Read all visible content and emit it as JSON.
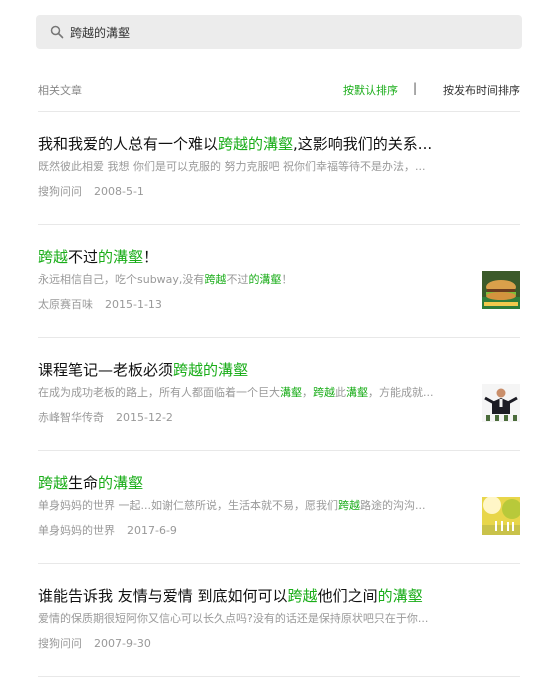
{
  "search": {
    "query": "跨越的溝壑"
  },
  "filter": {
    "label": "相关文章",
    "option_default": "按默认排序",
    "separator": "|",
    "option_time": "按发布时间排序"
  },
  "results": [
    {
      "title": [
        {
          "t": "我和我爱的人总有一个难以",
          "hl": false
        },
        {
          "t": "跨越的溝壑",
          "hl": true
        },
        {
          "t": ",这影响我们的关系...",
          "hl": false
        }
      ],
      "snippet": [
        {
          "t": "既然彼此相爱 我想 你们是可以克服的 努力克服吧 祝你们幸福等待不是办法，...",
          "hl": false
        }
      ],
      "source": "搜狗问问",
      "date": "2008-5-1",
      "thumb": null
    },
    {
      "title": [
        {
          "t": "跨越",
          "hl": true
        },
        {
          "t": "不过",
          "hl": false
        },
        {
          "t": "的溝壑",
          "hl": true
        },
        {
          "t": "！",
          "hl": false
        }
      ],
      "snippet": [
        {
          "t": "永远相信自己，吃个subway,没有",
          "hl": false
        },
        {
          "t": "跨越",
          "hl": true
        },
        {
          "t": "不过",
          "hl": false
        },
        {
          "t": "的溝壑",
          "hl": true
        },
        {
          "t": "！",
          "hl": false
        }
      ],
      "source": "太原赛百味",
      "date": "2015-1-13",
      "thumb": "sandwich"
    },
    {
      "title": [
        {
          "t": "课程笔记—老板必须",
          "hl": false
        },
        {
          "t": "跨越的溝壑",
          "hl": true
        }
      ],
      "snippet": [
        {
          "t": "在成为成功老板的路上，所有人都面临着一个巨大",
          "hl": false
        },
        {
          "t": "溝壑",
          "hl": true
        },
        {
          "t": "，",
          "hl": false
        },
        {
          "t": "跨越",
          "hl": true
        },
        {
          "t": "此",
          "hl": false
        },
        {
          "t": "溝壑",
          "hl": true
        },
        {
          "t": "，方能成就...",
          "hl": false
        }
      ],
      "source": "赤峰智华传奇",
      "date": "2015-12-2",
      "thumb": "boss"
    },
    {
      "title": [
        {
          "t": "跨越",
          "hl": true
        },
        {
          "t": "生命",
          "hl": false
        },
        {
          "t": "的溝壑",
          "hl": true
        }
      ],
      "snippet": [
        {
          "t": "单身妈妈的世界 一起...如谢仁慈所说，生活本就不易，愿我们",
          "hl": false
        },
        {
          "t": "跨越",
          "hl": true
        },
        {
          "t": "路途的沟沟...",
          "hl": false
        }
      ],
      "source": "单身妈妈的世界",
      "date": "2017-6-9",
      "thumb": "sunset"
    },
    {
      "title": [
        {
          "t": "谁能告诉我 友情与爱情 到底如何可以",
          "hl": false
        },
        {
          "t": "跨越",
          "hl": true
        },
        {
          "t": "他们之间",
          "hl": false
        },
        {
          "t": "的溝壑",
          "hl": true
        }
      ],
      "snippet": [
        {
          "t": "爱情的保质期很短阿你又信心可以长久点吗?没有的话还是保持原状吧只在于你...",
          "hl": false
        }
      ],
      "source": "搜狗问问",
      "date": "2007-9-30",
      "thumb": null
    }
  ]
}
